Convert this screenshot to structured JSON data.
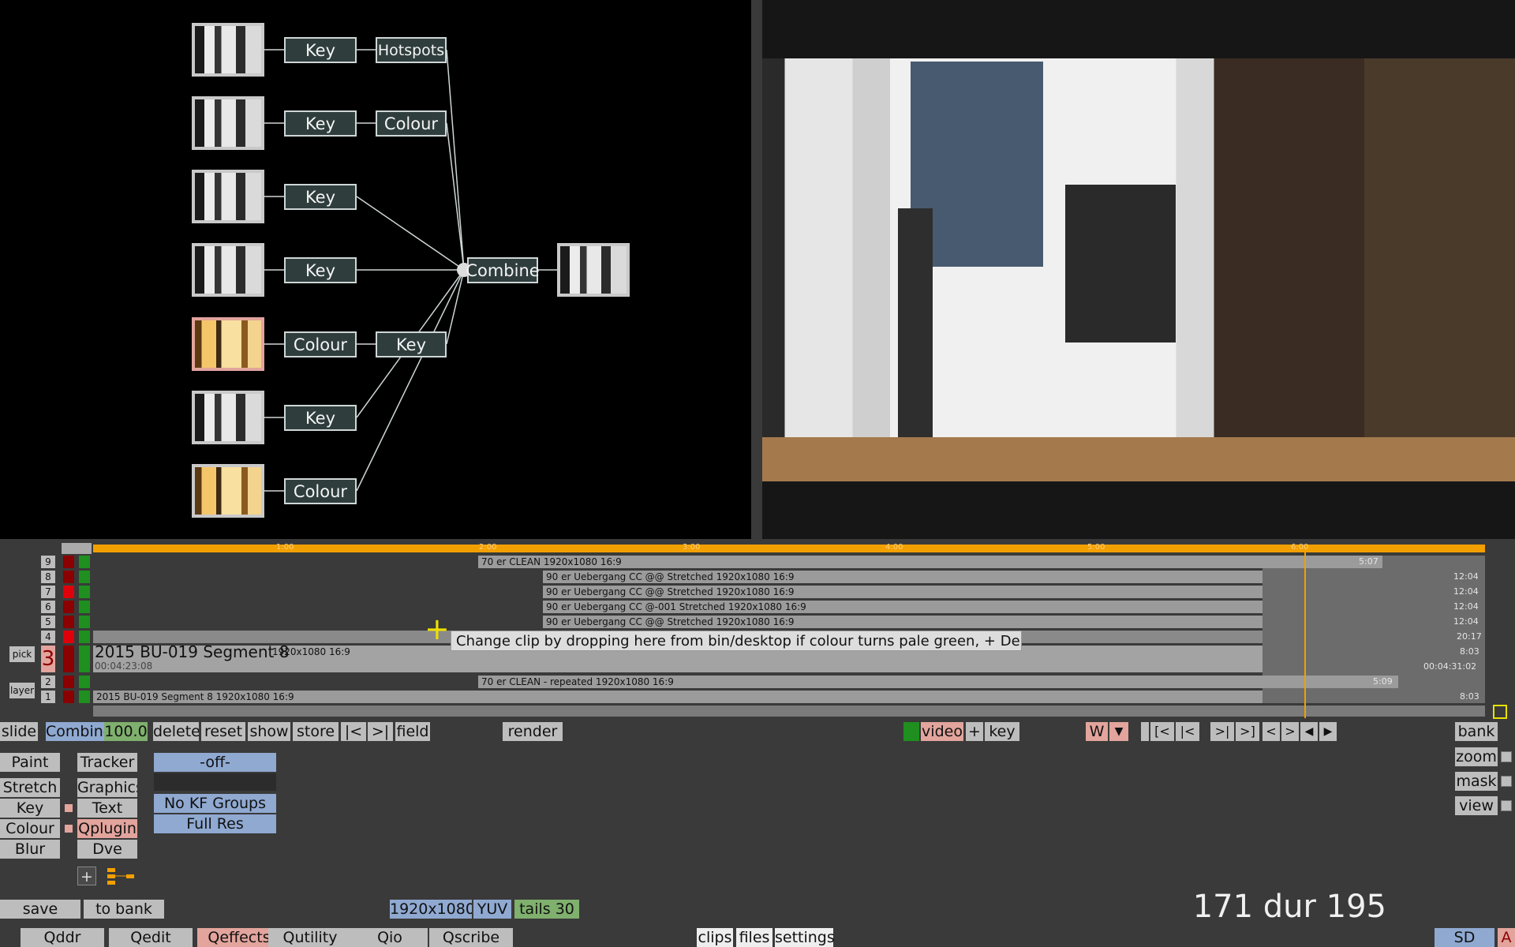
{
  "graph": {
    "nodes": {
      "n1a": "Key",
      "n1b": "Hotspots",
      "n2a": "Key",
      "n2b": "Colour",
      "n3a": "Key",
      "n4a": "Key",
      "n5a": "Colour",
      "n5b": "Key",
      "n6a": "Key",
      "n7a": "Colour",
      "combine": "Combine"
    }
  },
  "timeline": {
    "ruler_ticks": [
      "1:00",
      "2:00",
      "3:00",
      "4:00",
      "5:00",
      "6:00"
    ],
    "tracks": [
      {
        "num": "9",
        "label": "70 er CLEAN  1920x1080 16:9",
        "end": "5:07"
      },
      {
        "num": "8",
        "label": "90 er Uebergang CC @@ Stretched  1920x1080 16:9",
        "end": "12:04"
      },
      {
        "num": "7",
        "label": "90 er Uebergang CC @@ Stretched  1920x1080 16:9",
        "end": "12:04"
      },
      {
        "num": "6",
        "label": "90 er Uebergang CC @-001 Stretched  1920x1080 16:9",
        "end": "12:04"
      },
      {
        "num": "5",
        "label": "90 er Uebergang CC @@ Stretched  1920x1080 16:9",
        "end": "12:04"
      },
      {
        "num": "4",
        "label": "",
        "end": "20:17"
      },
      {
        "num": "3",
        "label": "2015 BU-019 Segment 8",
        "sub": "1920x1080 16:9",
        "start_tc": "00:04:23:08",
        "end": "8:03",
        "end_tc": "00:04:31:02"
      },
      {
        "num": "2",
        "label": "70 er CLEAN - repeated  1920x1080 16:9",
        "end": "5:09"
      },
      {
        "num": "1",
        "label": "2015 BU-019 Segment 8  1920x1080 16:9",
        "end": "8:03"
      }
    ],
    "pick": "pick",
    "layer": "layer",
    "current_layer": "3",
    "tooltip": "Change clip by dropping here from bin/desktop if colour turns pale green, + Delete d"
  },
  "toolbar": {
    "slide": "slide",
    "combine": "Combine",
    "combine_val": "100.0",
    "delete": "delete",
    "reset": "reset",
    "show": "show",
    "store": "store",
    "prev": "|<",
    "next": ">|",
    "field": "field",
    "render": "render",
    "video": "video",
    "plus": "+",
    "key": "key",
    "w": "W",
    "w_arrow": "▼",
    "transport": [
      "[<",
      "|<",
      ">|",
      ">]",
      "<",
      ">",
      "◀",
      "▶"
    ],
    "bank": "bank",
    "zoom": "zoom",
    "mask": "mask",
    "view": "view"
  },
  "effects": {
    "col1": [
      "Paint",
      "Stretch",
      "Key",
      "Colour",
      "Blur"
    ],
    "col2": [
      "Tracker",
      "Graphics",
      "Text",
      "Qplugin",
      "Dve"
    ],
    "off": "-off-",
    "kf": "No KF Groups",
    "res": "Full Res",
    "plus": "+"
  },
  "bottom": {
    "save": "save",
    "to_bank": "to bank",
    "res": "1920x1080",
    "yuv": "YUV",
    "tails": "tails 30",
    "counter": "171 dur 195",
    "tabs": [
      "Qddr",
      "Qedit",
      "Qeffects",
      "Qutility",
      "Qio",
      "Qscribe"
    ],
    "right_tabs": [
      "clips",
      "files",
      "settings"
    ],
    "sd": "SD",
    "a": "A"
  }
}
